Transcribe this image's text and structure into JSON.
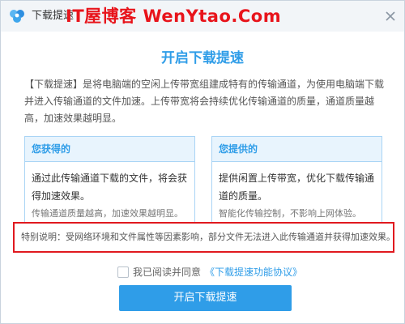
{
  "window": {
    "title": "下载提速",
    "app_icon": "cloud-logo-icon",
    "close_icon": "close-icon"
  },
  "watermark": "IT屋博客 WenYtao.Com",
  "heading": "开启下载提速",
  "intro": "【下载提速】是将电脑端的空闲上传带宽组建成特有的传输通道，为使用电脑端下载并进入传输通道的文件加速。上传带宽将会持续优化传输通道的质量，通道质量越高，加速效果越明显。",
  "cards": [
    {
      "title": "您获得的",
      "body": "通过此传输通道下载的文件，将会获得加速效果。",
      "note": "传输通道质量越高，加速效果越明显。"
    },
    {
      "title": "您提供的",
      "body": "提供闲置上传带宽，优化下载传输通道的质量。",
      "note": "智能化传输控制，不影响上网体验。"
    }
  ],
  "notice": "特别说明：受网络环境和文件属性等因素影响，部分文件无法进入此传输通道并获得加速效果。",
  "agreement": {
    "checked": false,
    "text": "我已阅读并同意",
    "link": "《下载提速功能协议》"
  },
  "primary_button": "开启下载提速",
  "colors": {
    "accent": "#2f9de8",
    "card_border": "#a9d4f5",
    "card_header_bg": "#e8f4fd",
    "titlebar_bg": "#f2f5f8",
    "highlight_red": "#e0191f",
    "watermark_red": "#e8141b"
  }
}
